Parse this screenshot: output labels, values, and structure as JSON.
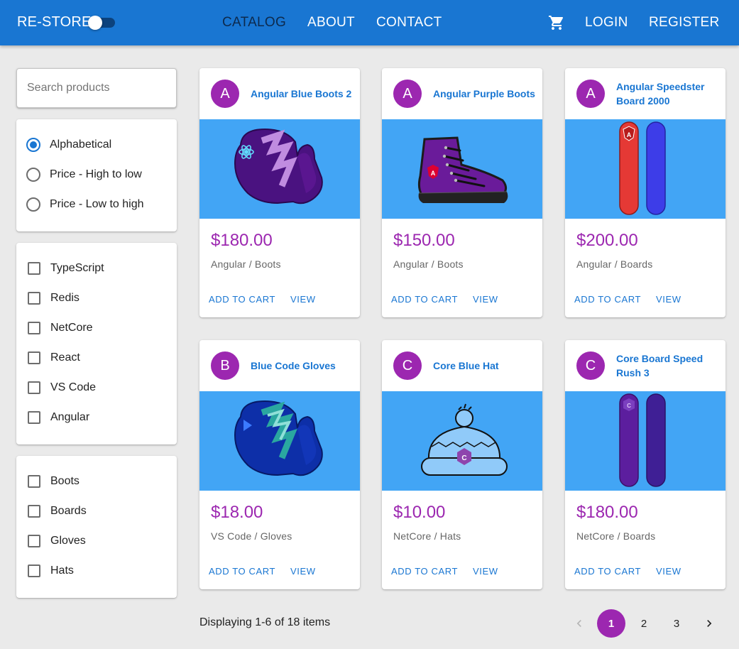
{
  "header": {
    "brand": "RE-STORE",
    "nav": [
      "CATALOG",
      "ABOUT",
      "CONTACT"
    ],
    "login": "LOGIN",
    "register": "REGISTER",
    "cart_icon": "shopping-cart-icon",
    "dark_mode_toggle": false
  },
  "sidebar": {
    "search_placeholder": "Search products",
    "sort_options": [
      "Alphabetical",
      "Price - High to low",
      "Price - Low to high"
    ],
    "sort_selected": "Alphabetical",
    "brands": [
      "TypeScript",
      "Redis",
      "NetCore",
      "React",
      "VS Code",
      "Angular"
    ],
    "types": [
      "Boots",
      "Boards",
      "Gloves",
      "Hats"
    ]
  },
  "products": [
    {
      "avatar": "A",
      "name": "Angular Blue Boots 2",
      "price": "$180.00",
      "category": "Angular / Boots",
      "add": "ADD TO CART",
      "view": "VIEW"
    },
    {
      "avatar": "A",
      "name": "Angular Purple Boots",
      "price": "$150.00",
      "category": "Angular / Boots",
      "add": "ADD TO CART",
      "view": "VIEW"
    },
    {
      "avatar": "A",
      "name": "Angular Speedster Board 2000",
      "price": "$200.00",
      "category": "Angular / Boards",
      "add": "ADD TO CART",
      "view": "VIEW"
    },
    {
      "avatar": "B",
      "name": "Blue Code Gloves",
      "price": "$18.00",
      "category": "VS Code / Gloves",
      "add": "ADD TO CART",
      "view": "VIEW"
    },
    {
      "avatar": "C",
      "name": "Core Blue Hat",
      "price": "$10.00",
      "category": "NetCore / Hats",
      "add": "ADD TO CART",
      "view": "VIEW"
    },
    {
      "avatar": "C",
      "name": "Core Board Speed Rush 3",
      "price": "$180.00",
      "category": "NetCore / Boards",
      "add": "ADD TO CART",
      "view": "VIEW"
    }
  ],
  "footer": {
    "display": "Displaying 1-6 of 18 items",
    "pages": [
      "1",
      "2",
      "3"
    ],
    "current_page": "1",
    "prev_icon": "chevron-left-icon",
    "next_icon": "chevron-right-icon"
  },
  "colors": {
    "primary": "#1976d2",
    "secondary": "#9c27b0",
    "media_bg": "#42a5f5",
    "background": "#eaeaea"
  }
}
